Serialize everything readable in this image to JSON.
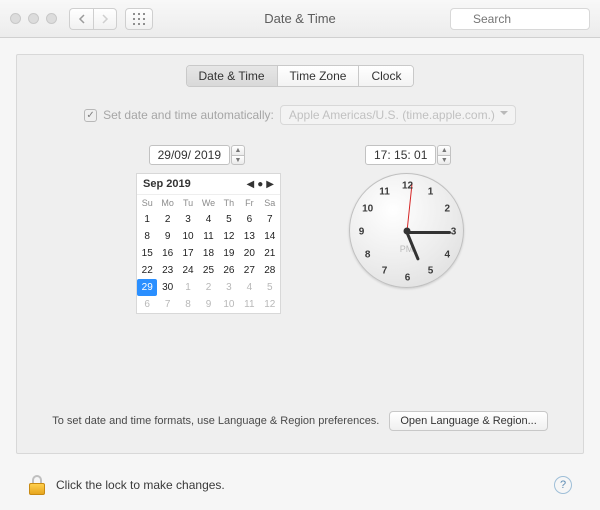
{
  "window": {
    "title": "Date & Time",
    "search_placeholder": "Search"
  },
  "tabs": {
    "items": [
      "Date & Time",
      "Time Zone",
      "Clock"
    ],
    "active": 0
  },
  "auto": {
    "label": "Set date and time automatically:",
    "checked": true,
    "server": "Apple Americas/U.S. (time.apple.com.)"
  },
  "date_field": "29/09/ 2019",
  "time_field": "17: 15: 01",
  "calendar": {
    "title": "Sep 2019",
    "weekdays": [
      "Su",
      "Mo",
      "Tu",
      "We",
      "Th",
      "Fr",
      "Sa"
    ],
    "cells": [
      {
        "d": "1"
      },
      {
        "d": "2"
      },
      {
        "d": "3"
      },
      {
        "d": "4"
      },
      {
        "d": "5"
      },
      {
        "d": "6"
      },
      {
        "d": "7"
      },
      {
        "d": "8"
      },
      {
        "d": "9"
      },
      {
        "d": "10"
      },
      {
        "d": "11"
      },
      {
        "d": "12"
      },
      {
        "d": "13"
      },
      {
        "d": "14"
      },
      {
        "d": "15"
      },
      {
        "d": "16"
      },
      {
        "d": "17"
      },
      {
        "d": "18"
      },
      {
        "d": "19"
      },
      {
        "d": "20"
      },
      {
        "d": "21"
      },
      {
        "d": "22"
      },
      {
        "d": "23"
      },
      {
        "d": "24"
      },
      {
        "d": "25"
      },
      {
        "d": "26"
      },
      {
        "d": "27"
      },
      {
        "d": "28"
      },
      {
        "d": "29",
        "sel": true
      },
      {
        "d": "30"
      },
      {
        "d": "1",
        "dim": true
      },
      {
        "d": "2",
        "dim": true
      },
      {
        "d": "3",
        "dim": true
      },
      {
        "d": "4",
        "dim": true
      },
      {
        "d": "5",
        "dim": true
      },
      {
        "d": "6",
        "dim": true
      },
      {
        "d": "7",
        "dim": true
      },
      {
        "d": "8",
        "dim": true
      },
      {
        "d": "9",
        "dim": true
      },
      {
        "d": "10",
        "dim": true
      },
      {
        "d": "11",
        "dim": true
      },
      {
        "d": "12",
        "dim": true
      }
    ]
  },
  "clock": {
    "hours": 17,
    "minutes": 15,
    "seconds": 1,
    "ampm": "PM",
    "numbers": [
      "12",
      "1",
      "2",
      "3",
      "4",
      "5",
      "6",
      "7",
      "8",
      "9",
      "10",
      "11"
    ]
  },
  "format": {
    "text": "To set date and time formats, use Language & Region preferences.",
    "button": "Open Language & Region..."
  },
  "footer": {
    "text": "Click the lock to make changes."
  }
}
